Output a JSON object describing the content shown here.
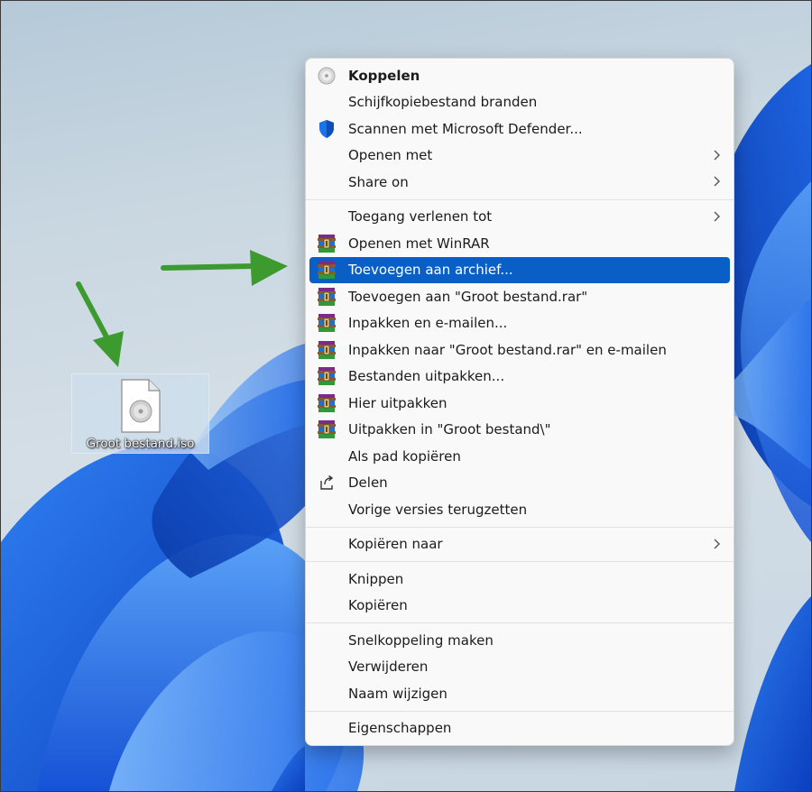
{
  "desktop": {
    "file_label": "Groot bestand.iso",
    "file_icon": "disc-image-file-icon"
  },
  "colors": {
    "highlight": "#0a5fc6",
    "arrow": "#3c9a2e",
    "wallpaper_blue": "#1f5fd8"
  },
  "menu": {
    "sections": [
      {
        "items": [
          {
            "name": "menu-item-koppelen",
            "label": "Koppelen",
            "icon": "disc-icon",
            "bold": true
          },
          {
            "name": "menu-item-schijfkopie-branden",
            "label": "Schijfkopiebestand branden",
            "icon": ""
          },
          {
            "name": "menu-item-scannen-defender",
            "label": "Scannen met Microsoft Defender...",
            "icon": "shield-icon"
          },
          {
            "name": "menu-item-openen-met",
            "label": "Openen met",
            "icon": "",
            "submenu": true
          },
          {
            "name": "menu-item-share-on",
            "label": "Share on",
            "icon": "",
            "submenu": true
          }
        ]
      },
      {
        "items": [
          {
            "name": "menu-item-toegang-verlenen",
            "label": "Toegang verlenen tot",
            "icon": "",
            "submenu": true
          },
          {
            "name": "menu-item-openen-winrar",
            "label": "Openen met WinRAR",
            "icon": "winrar-icon"
          },
          {
            "name": "menu-item-toevoegen-archief",
            "label": "Toevoegen aan archief...",
            "icon": "winrar-icon",
            "highlighted": true
          },
          {
            "name": "menu-item-toevoegen-rar",
            "label": "Toevoegen aan \"Groot bestand.rar\"",
            "icon": "winrar-icon"
          },
          {
            "name": "menu-item-inpakken-mailen",
            "label": "Inpakken en e-mailen...",
            "icon": "winrar-icon"
          },
          {
            "name": "menu-item-inpakken-rar-mailen",
            "label": "Inpakken naar \"Groot bestand.rar\" en e-mailen",
            "icon": "winrar-icon"
          },
          {
            "name": "menu-item-bestanden-uitpakken",
            "label": "Bestanden uitpakken...",
            "icon": "winrar-icon"
          },
          {
            "name": "menu-item-hier-uitpakken",
            "label": "Hier uitpakken",
            "icon": "winrar-icon"
          },
          {
            "name": "menu-item-uitpakken-in",
            "label": "Uitpakken in \"Groot bestand\\\"",
            "icon": "winrar-icon"
          },
          {
            "name": "menu-item-als-pad-kopieren",
            "label": "Als pad kopiëren",
            "icon": ""
          },
          {
            "name": "menu-item-delen",
            "label": "Delen",
            "icon": "share-icon"
          },
          {
            "name": "menu-item-vorige-versies",
            "label": "Vorige versies terugzetten",
            "icon": ""
          }
        ]
      },
      {
        "items": [
          {
            "name": "menu-item-kopieren-naar",
            "label": "Kopiëren naar",
            "icon": "",
            "submenu": true
          }
        ]
      },
      {
        "items": [
          {
            "name": "menu-item-knippen",
            "label": "Knippen",
            "icon": ""
          },
          {
            "name": "menu-item-kopieren",
            "label": "Kopiëren",
            "icon": ""
          }
        ]
      },
      {
        "items": [
          {
            "name": "menu-item-snelkoppeling",
            "label": "Snelkoppeling maken",
            "icon": ""
          },
          {
            "name": "menu-item-verwijderen",
            "label": "Verwijderen",
            "icon": ""
          },
          {
            "name": "menu-item-naam-wijzigen",
            "label": "Naam wijzigen",
            "icon": ""
          }
        ]
      },
      {
        "items": [
          {
            "name": "menu-item-eigenschappen",
            "label": "Eigenschappen",
            "icon": ""
          }
        ]
      }
    ]
  }
}
